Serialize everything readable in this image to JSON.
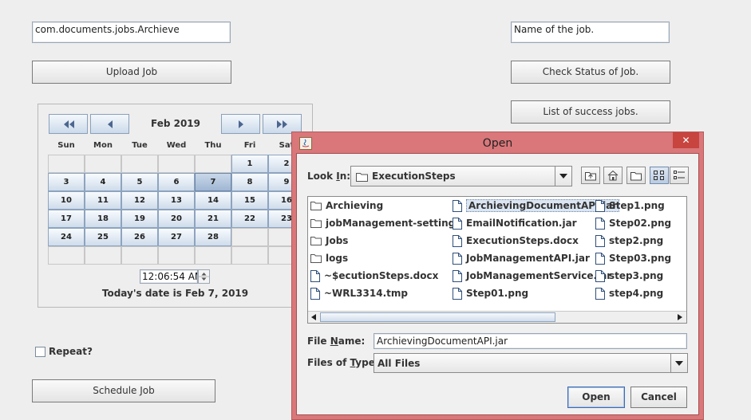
{
  "form": {
    "class_field_value": "com.documents.jobs.Archieve",
    "job_name_value": "Name of the job.",
    "upload_label": "Upload Job",
    "check_status_label": "Check Status of Job.",
    "list_success_label": "List of success jobs.",
    "repeat_label": "Repeat?",
    "repeat_checked": false,
    "schedule_label": "Schedule Job"
  },
  "calendar": {
    "month_label": "Feb 2019",
    "day_headers": [
      "Sun",
      "Mon",
      "Tue",
      "Wed",
      "Thu",
      "Fri",
      "Sat"
    ],
    "weeks": [
      [
        "",
        "",
        "",
        "",
        "",
        "1",
        "2"
      ],
      [
        "3",
        "4",
        "5",
        "6",
        "7",
        "8",
        "9"
      ],
      [
        "10",
        "11",
        "12",
        "13",
        "14",
        "15",
        "16"
      ],
      [
        "17",
        "18",
        "19",
        "20",
        "21",
        "22",
        "23"
      ],
      [
        "24",
        "25",
        "26",
        "27",
        "28",
        "",
        ""
      ],
      [
        "",
        "",
        "",
        "",
        "",
        "",
        ""
      ]
    ],
    "selected_day": "7",
    "time_value": "12:06:54 AM",
    "today_label": "Today's date is Feb 7, 2019"
  },
  "dialog": {
    "title": "Open",
    "look_in_label_pre": "Look ",
    "look_in_label_mnemonic": "I",
    "look_in_label_post": "n:",
    "look_in_value": "ExecutionSteps",
    "files": [
      {
        "name": "Archieving",
        "type": "folder"
      },
      {
        "name": "jobManagement-settings",
        "type": "folder"
      },
      {
        "name": "Jobs",
        "type": "folder"
      },
      {
        "name": "logs",
        "type": "folder"
      },
      {
        "name": "~$ecutionSteps.docx",
        "type": "file"
      },
      {
        "name": "~WRL3314.tmp",
        "type": "file"
      },
      {
        "name": "ArchievingDocumentAPI.jar",
        "type": "file",
        "selected": true
      },
      {
        "name": "EmailNotification.jar",
        "type": "file"
      },
      {
        "name": "ExecutionSteps.docx",
        "type": "file"
      },
      {
        "name": "JobManagementAPI.jar",
        "type": "file"
      },
      {
        "name": "JobManagementService.jar",
        "type": "file"
      },
      {
        "name": "Step01.png",
        "type": "file"
      },
      {
        "name": "Step1.png",
        "type": "file"
      },
      {
        "name": "Step02.png",
        "type": "file"
      },
      {
        "name": "step2.png",
        "type": "file"
      },
      {
        "name": "Step03.png",
        "type": "file"
      },
      {
        "name": "step3.png",
        "type": "file"
      },
      {
        "name": "step4.png",
        "type": "file"
      }
    ],
    "file_name_label_pre": "File ",
    "file_name_label_mnemonic": "N",
    "file_name_label_post": "ame:",
    "file_name_value": "ArchievingDocumentAPI.jar",
    "file_type_label_pre": "Files of ",
    "file_type_label_mnemonic": "T",
    "file_type_label_post": "ype:",
    "file_type_value": "All Files",
    "open_label": "Open",
    "cancel_label": "Cancel",
    "close_glyph": "✕"
  },
  "icons": [
    "java-icon",
    "folder-icon",
    "file-icon",
    "up-folder-icon",
    "home-icon",
    "new-folder-icon",
    "list-view-icon",
    "details-view-icon",
    "combo-arrow-icon",
    "first-month-icon",
    "prev-month-icon",
    "next-month-icon",
    "last-month-icon",
    "spinner-icon",
    "close-icon"
  ],
  "colors": {
    "dialog_frame": "#d9777a",
    "close_button": "#c8443f",
    "selection": "#dce6f2"
  }
}
